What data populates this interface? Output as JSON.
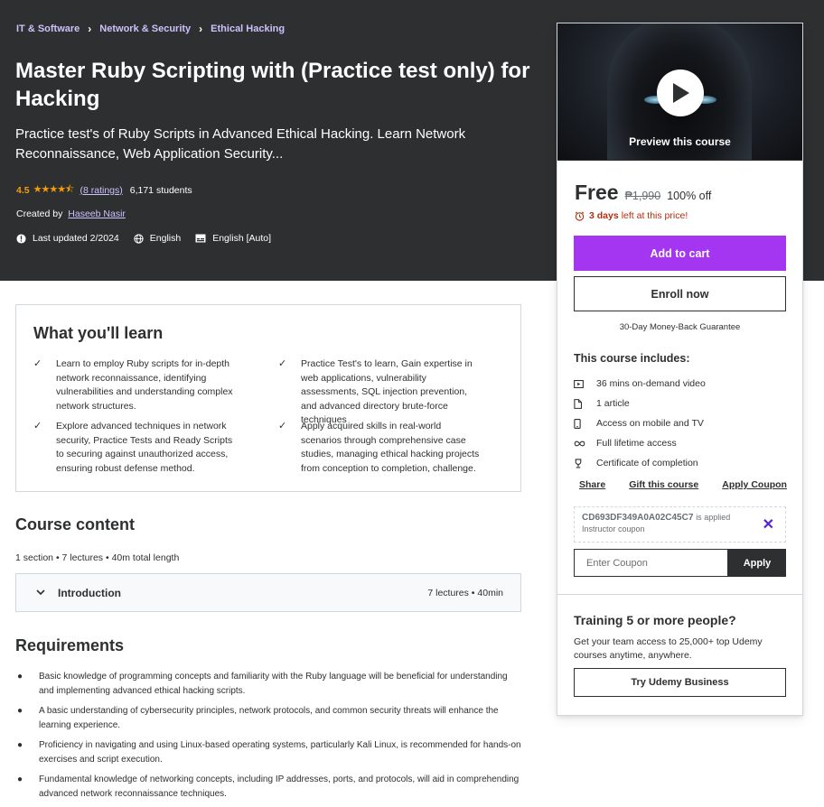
{
  "breadcrumb": [
    "IT & Software",
    "Network & Security",
    "Ethical Hacking"
  ],
  "course": {
    "title": "Master Ruby Scripting with (Practice test only) for Hacking",
    "subtitle": "Practice test's of Ruby Scripts in Advanced Ethical Hacking. Learn Network Reconnaissance, Web Application Security...",
    "rating": "4.5",
    "rating_value": 4.5,
    "ratings_link": "(8 ratings)",
    "students": "6,171 students",
    "created_by_label": "Created by",
    "author": "Haseeb Nasir",
    "last_updated": "Last updated 2/2024",
    "language": "English",
    "captions": "English [Auto]"
  },
  "sidebar": {
    "preview_label": "Preview this course",
    "price": "Free",
    "original_price": "₱1,990",
    "discount": "100% off",
    "timer_days": "3 days",
    "timer_rest": "left at this price!",
    "add_to_cart": "Add to cart",
    "enroll_now": "Enroll now",
    "guarantee": "30-Day Money-Back Guarantee",
    "includes_title": "This course includes:",
    "includes": [
      {
        "icon": "video-icon",
        "text": "36 mins on-demand video"
      },
      {
        "icon": "file-icon",
        "text": "1 article"
      },
      {
        "icon": "mobile-icon",
        "text": "Access on mobile and TV"
      },
      {
        "icon": "infinity-icon",
        "text": "Full lifetime access"
      },
      {
        "icon": "trophy-icon",
        "text": "Certificate of completion"
      }
    ],
    "share": "Share",
    "gift": "Gift this course",
    "apply_coupon": "Apply Coupon",
    "coupon_code": "CD693DF349A0A02C45C7",
    "coupon_applied": "is applied",
    "coupon_sub": "Instructor coupon",
    "coupon_placeholder": "Enter Coupon",
    "coupon_apply_btn": "Apply",
    "business_title": "Training 5 or more people?",
    "business_text": "Get your team access to 25,000+ top Udemy courses anytime, anywhere.",
    "business_btn": "Try Udemy Business"
  },
  "learn": {
    "title": "What you'll learn",
    "items": [
      "Learn to employ Ruby scripts for in-depth network reconnaissance, identifying vulnerabilities and understanding complex network structures.",
      "Practice Test's to learn, Gain expertise in web applications, vulnerability assessments, SQL injection prevention, and advanced directory brute-force techniques",
      "Explore advanced techniques in network security, Practice Tests and Ready Scripts to securing against unauthorized access, ensuring robust defense method.",
      "Apply acquired skills in real-world scenarios through comprehensive case studies, managing ethical hacking projects from conception to completion, challenge."
    ]
  },
  "content": {
    "title": "Course content",
    "meta": "1 section • 7 lectures • 40m total length",
    "sections": [
      {
        "title": "Introduction",
        "count": "7 lectures • 40min"
      }
    ]
  },
  "requirements": {
    "title": "Requirements",
    "items": [
      "Basic knowledge of programming concepts and familiarity with the Ruby language will be beneficial for understanding and implementing advanced ethical hacking scripts.",
      "A basic understanding of cybersecurity principles, network protocols, and common security threats will enhance the learning experience.",
      "Proficiency in navigating and using Linux-based operating systems, particularly Kali Linux, is recommended for hands-on exercises and script execution.",
      "Fundamental knowledge of networking concepts, including IP addresses, ports, and protocols, will aid in comprehending advanced network reconnaissance techniques."
    ]
  },
  "colors": {
    "hero_bg": "#2d2f31",
    "accent_purple": "#a435f0",
    "star": "#f69c08",
    "timer_red": "#b32d0f",
    "link_lavender": "#cec0fc"
  }
}
